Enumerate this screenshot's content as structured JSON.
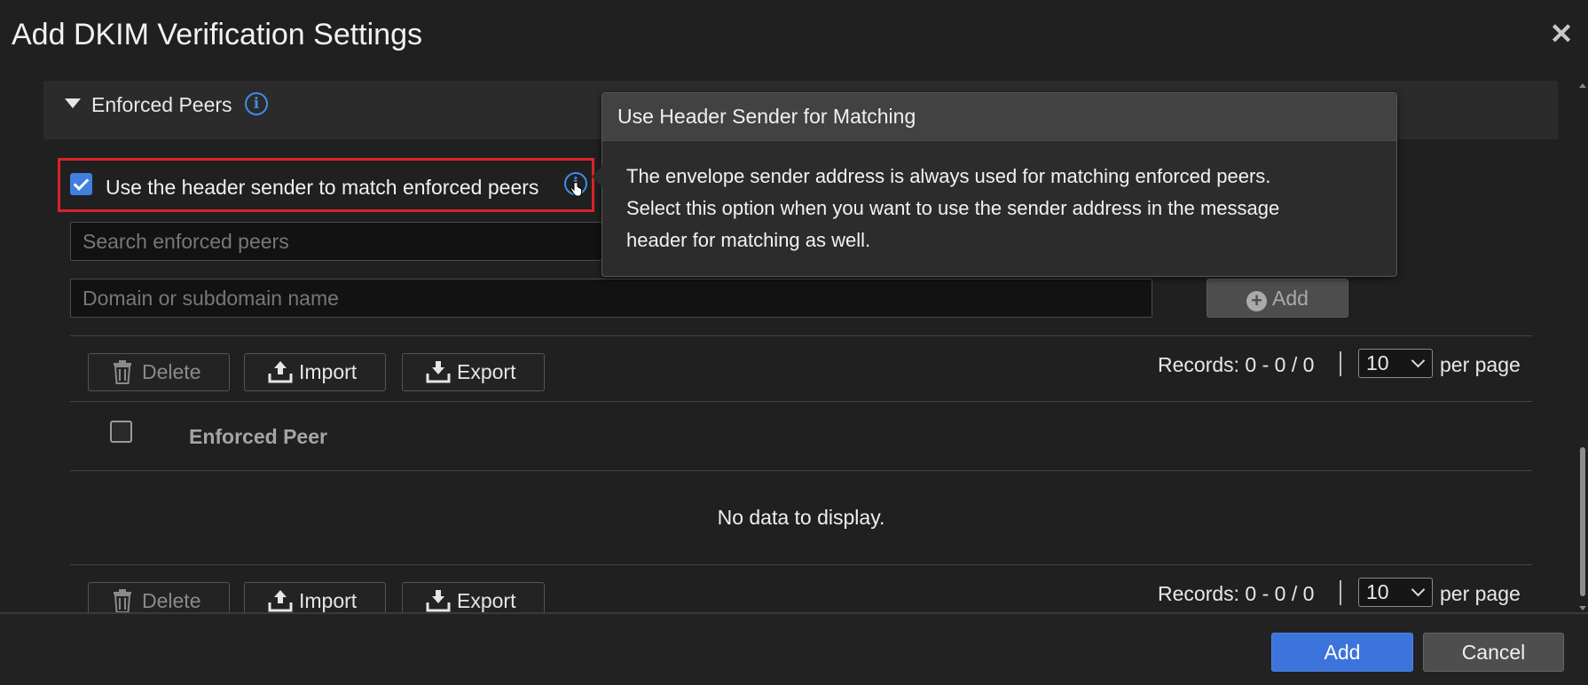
{
  "dialog": {
    "title": "Add DKIM Verification Settings",
    "close_label": "✕"
  },
  "section": {
    "title": "Enforced Peers",
    "info_glyph": "i"
  },
  "header_sender": {
    "label": "Use the header sender to match enforced peers",
    "checked": true,
    "info_glyph": "i"
  },
  "search": {
    "placeholder": "Search enforced peers"
  },
  "domain": {
    "placeholder": "Domain or subdomain name"
  },
  "add_peer_button": {
    "plus": "+",
    "label": "Add"
  },
  "toolbar": {
    "delete": "Delete",
    "import": "Import",
    "export": "Export"
  },
  "pagination": {
    "records": "Records: 0 - 0 / 0",
    "page_size": "10",
    "per_page": "per page"
  },
  "table": {
    "column_header": "Enforced Peer",
    "empty_message": "No data to display."
  },
  "footer": {
    "add": "Add",
    "cancel": "Cancel"
  },
  "tooltip": {
    "title": "Use Header Sender for Matching",
    "lines": [
      "The envelope sender address is always used for matching enforced peers.",
      "Select this option when you want to use the sender address in the message",
      "header for matching as well."
    ]
  },
  "colors": {
    "highlight": "#d9232a",
    "accent": "#3d74db",
    "info": "#3d8ee6"
  }
}
